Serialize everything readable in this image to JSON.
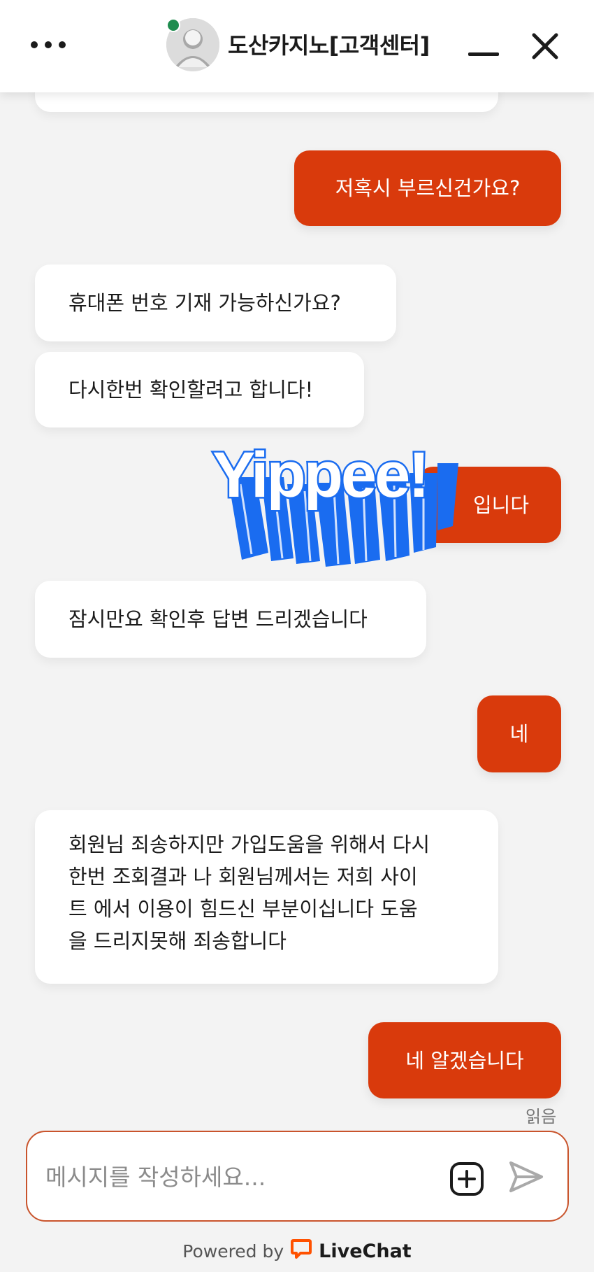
{
  "header": {
    "title": "도산카지노[고객센터]",
    "online": true,
    "accent_online": "#1e8c4e"
  },
  "messages": [
    {
      "from": "visitor",
      "text": "저혹시 부르신건가요?"
    },
    {
      "from": "agent",
      "text": "휴대폰 번호 기재 가능하신가요?"
    },
    {
      "from": "agent",
      "text": "다시한번 확인할려고 합니다!"
    },
    {
      "from": "visitor",
      "text": "입니다",
      "partially_covered_by_sticker": true
    },
    {
      "from": "agent",
      "text": "잠시만요 확인후 답변 드리겠습니다"
    },
    {
      "from": "visitor",
      "text": "네"
    },
    {
      "from": "agent",
      "lines": [
        "회원님 죄송하지만 가입도움을 위해서 다시",
        "한번 조회결과 나 회원님께서는 저희 사이",
        "트 에서 이용이 힘드신 부분이십니다 도움",
        "을 드리지못해 죄송합니다"
      ]
    },
    {
      "from": "visitor",
      "text": "네 알겠습니다"
    }
  ],
  "read_status": "읽음",
  "sticker": {
    "text": "Yippee!",
    "color": "#1a6cf0"
  },
  "composer": {
    "placeholder": "메시지를 작성하세요..."
  },
  "footer": {
    "powered_by": "Powered by",
    "brand": "LiveChat"
  },
  "colors": {
    "visitor_bubble": "#d93a0c",
    "agent_bubble": "#ffffff",
    "background": "#f3f3f3",
    "brand_icon": "#ff5100"
  },
  "icons": [
    "menu-dots-icon",
    "avatar-icon",
    "minimize-icon",
    "close-icon",
    "add-attachment-icon",
    "send-icon",
    "livechat-logo-icon"
  ]
}
